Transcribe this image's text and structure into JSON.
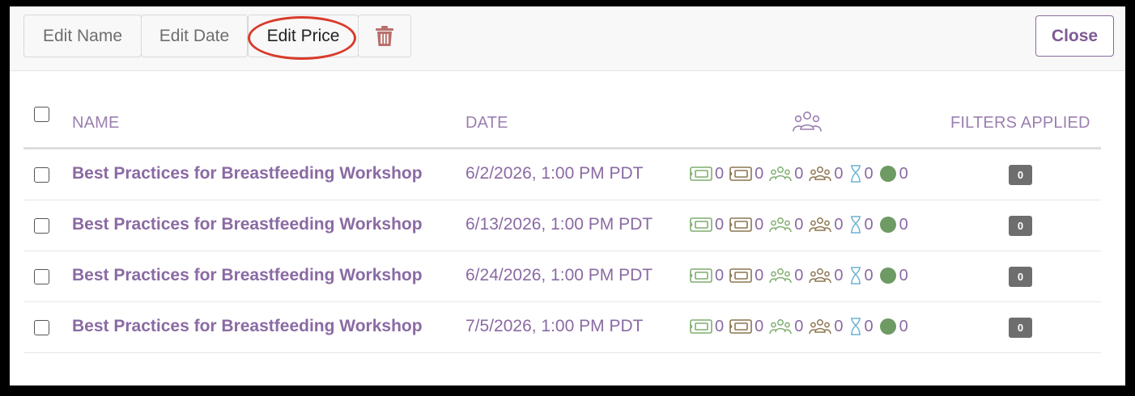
{
  "toolbar": {
    "edit_name": "Edit Name",
    "edit_date": "Edit Date",
    "edit_price": "Edit Price",
    "close": "Close"
  },
  "table": {
    "headers": {
      "name": "NAME",
      "date": "DATE",
      "filters": "FILTERS APPLIED"
    },
    "rows": [
      {
        "name": "Best Practices for Breastfeeding Workshop",
        "date": "6/2/2026, 1:00 PM PDT",
        "stats": [
          "0",
          "0",
          "0",
          "0",
          "0",
          "0"
        ],
        "filters": "0"
      },
      {
        "name": "Best Practices for Breastfeeding Workshop",
        "date": "6/13/2026, 1:00 PM PDT",
        "stats": [
          "0",
          "0",
          "0",
          "0",
          "0",
          "0"
        ],
        "filters": "0"
      },
      {
        "name": "Best Practices for Breastfeeding Workshop",
        "date": "6/24/2026, 1:00 PM PDT",
        "stats": [
          "0",
          "0",
          "0",
          "0",
          "0",
          "0"
        ],
        "filters": "0"
      },
      {
        "name": "Best Practices for Breastfeeding Workshop",
        "date": "7/5/2026, 1:00 PM PDT",
        "stats": [
          "0",
          "0",
          "0",
          "0",
          "0",
          "0"
        ],
        "filters": "0"
      }
    ]
  },
  "stat_icons": [
    "ticket-icon",
    "ticket-outline-icon",
    "attendees-icon",
    "group-icon",
    "hourglass-icon",
    "status-dot-icon"
  ],
  "colors": {
    "accent_purple": "#8a6aa3",
    "header_purple": "#9b7fb0",
    "ticket_green": "#7fae6e",
    "ticket_brown": "#8c7650",
    "hourglass_blue": "#6fb3d2",
    "status_green": "#6e9a63",
    "trash_red": "#b8706b",
    "highlight_red": "#d93b2b"
  }
}
